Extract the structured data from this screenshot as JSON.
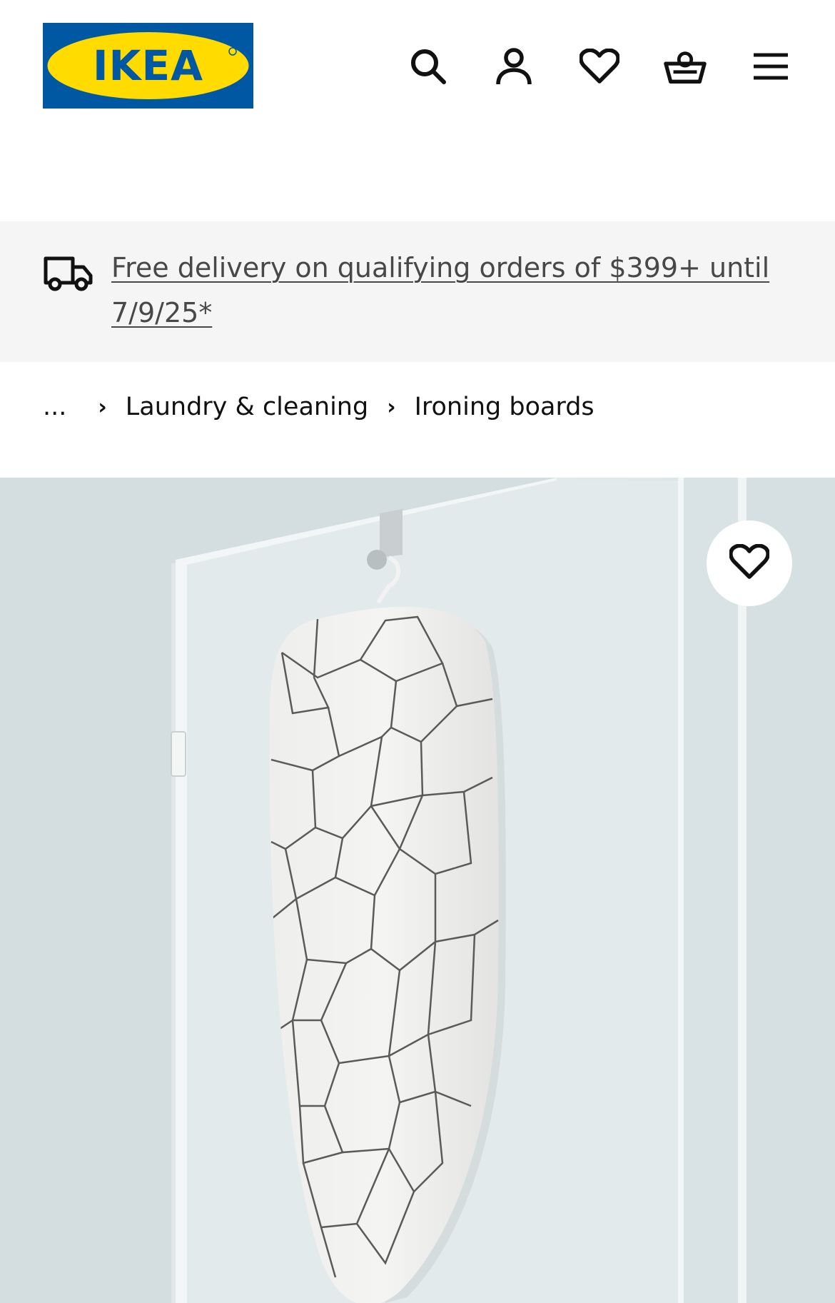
{
  "header": {
    "logo_text": "IKEA",
    "icons": [
      "search-icon",
      "account-icon",
      "heart-icon",
      "basket-icon",
      "menu-icon"
    ],
    "brand_blue": "#0058a3",
    "brand_yellow": "#ffdb00"
  },
  "banner": {
    "icon": "truck-icon",
    "text": "Free delivery on qualifying orders of $399+ until 7/9/25*",
    "background": "#f5f5f5"
  },
  "breadcrumb": {
    "ellipsis": "...",
    "items": [
      "Laundry & cleaning",
      "Ironing boards"
    ]
  },
  "product_image": {
    "favorite_icon": "heart-icon"
  }
}
